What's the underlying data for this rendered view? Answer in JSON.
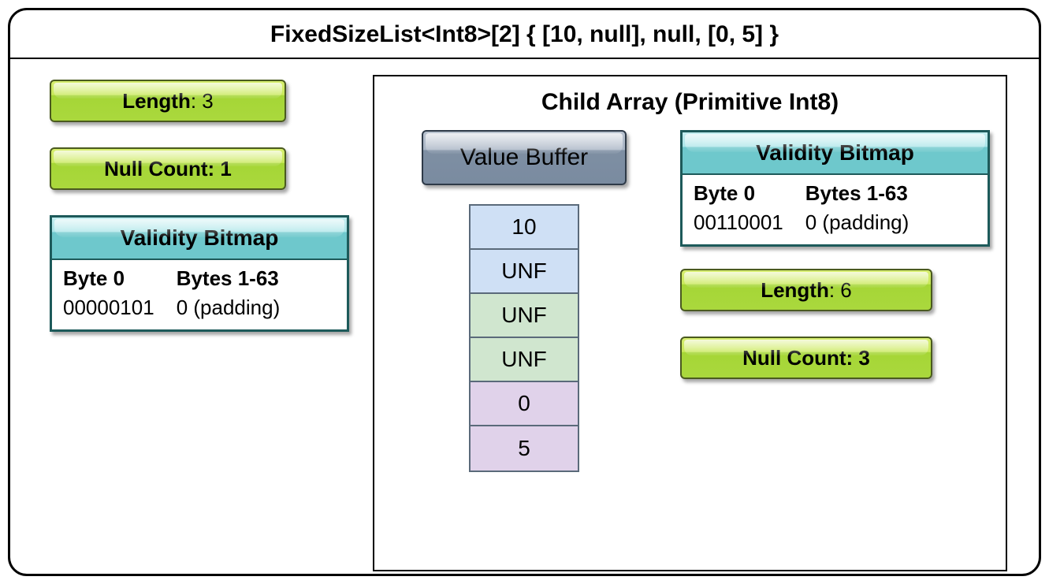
{
  "title": "FixedSizeList<Int8>[2] { [10, null], null, [0, 5] }",
  "parent": {
    "length_label": "Length",
    "length_value": ": 3",
    "nullcount": "Null Count: 1",
    "validity": {
      "title": "Validity Bitmap",
      "col0_h": "Byte 0",
      "col1_h": "Bytes 1-63",
      "col0_v": "00000101",
      "col1_v": "0 (padding)"
    }
  },
  "child": {
    "title": "Child Array (Primitive Int8)",
    "value_buffer_label": "Value Buffer",
    "cells": [
      "10",
      "UNF",
      "UNF",
      "UNF",
      "0",
      "5"
    ],
    "cell_colors": [
      "c-blue",
      "c-blue",
      "c-green",
      "c-green",
      "c-purple",
      "c-purple"
    ],
    "validity": {
      "title": "Validity Bitmap",
      "col0_h": "Byte 0",
      "col1_h": "Bytes 1-63",
      "col0_v": "00110001",
      "col1_v": "0 (padding)"
    },
    "length_label": "Length",
    "length_value": ": 6",
    "nullcount": "Null Count: 3"
  }
}
